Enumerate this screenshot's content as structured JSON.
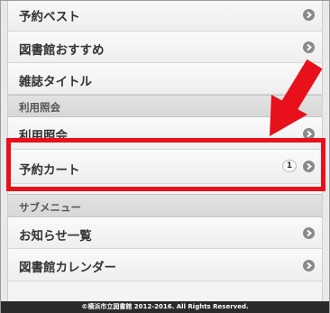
{
  "menu": {
    "items_top": [
      {
        "label": "予約ベスト"
      },
      {
        "label": "図書館おすすめ"
      },
      {
        "label": "雑誌タイトル"
      }
    ],
    "section_inquiry": "利用照会",
    "inquiry_items": [
      {
        "label": "利用照会"
      },
      {
        "label": "予約カート",
        "badge": "1"
      }
    ],
    "section_submenu": "サブメニュー",
    "submenu_items": [
      {
        "label": "お知らせ一覧"
      },
      {
        "label": "図書館カレンダー"
      }
    ]
  },
  "footer": {
    "copyright": "©横浜市立図書館 2012-2016. All Rights Reserved."
  },
  "annotation": {
    "highlight_color": "#e8101a",
    "arrow_color": "#e8101a",
    "arrow_icon": "arrow-down-left-icon"
  }
}
